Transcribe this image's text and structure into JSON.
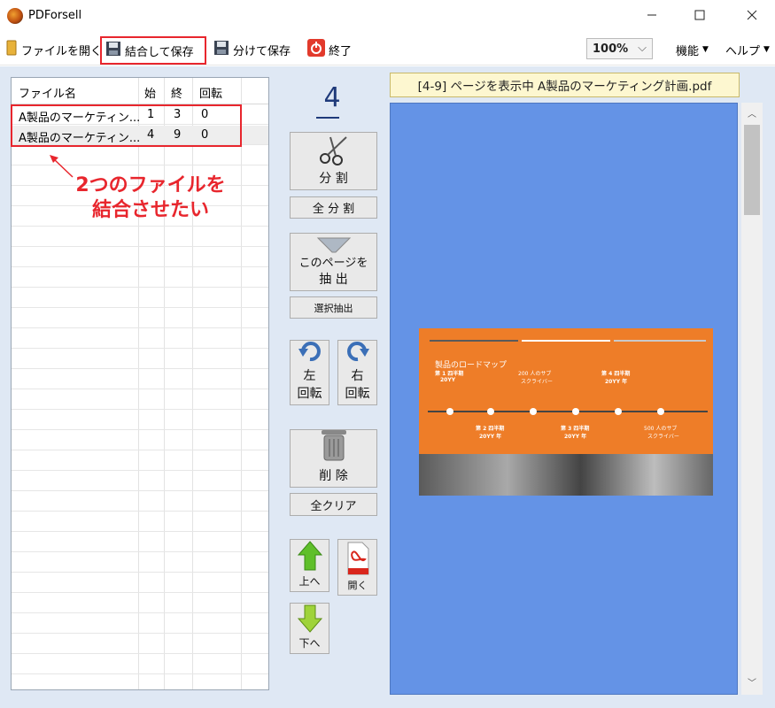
{
  "window": {
    "title": "PDForsell",
    "minimize_icon": "minimize-icon",
    "maximize_icon": "maximize-icon",
    "close_icon": "close-icon"
  },
  "toolbar": {
    "open_label": "ファイルを開く",
    "merge_save_label": "結合して保存",
    "split_save_label": "分けて保存",
    "exit_label": "終了",
    "zoom_value": "100%",
    "features_label": "機能",
    "help_label": "ヘルプ"
  },
  "table": {
    "headers": [
      "ファイル名",
      "始",
      "終",
      "回転"
    ],
    "rows": [
      {
        "name": "A製品のマーケティン...",
        "start": "1",
        "end": "3",
        "rotation": "0"
      },
      {
        "name": "A製品のマーケティン...",
        "start": "4",
        "end": "9",
        "rotation": "0"
      }
    ]
  },
  "annotation": {
    "line1": "2つのファイルを",
    "line2": "結合させたい",
    "color": "#e8262d"
  },
  "controls": {
    "page_count": "4",
    "split_label": "分 割",
    "split_all_label": "全 分 割",
    "extract_label_1": "このページを",
    "extract_label_2": "抽 出",
    "select_extract_label": "選択抽出",
    "rotate_left_1": "左",
    "rotate_left_2": "回転",
    "rotate_right_1": "右",
    "rotate_right_2": "回転",
    "delete_label": "削 除",
    "clear_all_label": "全クリア",
    "move_up_label": "上へ",
    "open_pdf_label": "開く",
    "move_down_label": "下へ"
  },
  "preview": {
    "status": "[4-9] ページを表示中  A製品のマーケティング計画.pdf",
    "slide": {
      "title": "製品のロードマップ",
      "col1_head": "第 1 四半期",
      "col1_year": "20YY",
      "col2_head": "200 人のサブ",
      "col2_sub": "スクライバー",
      "col3_head": "第 4 四半期",
      "col3_year": "20YY 年",
      "low1_head": "第 2 四半期",
      "low1_year": "20YY 年",
      "low2_head": "第 3 四半期",
      "low2_year": "20YY 年",
      "low3_head": "500 人のサブ",
      "low3_sub": "スクライバー"
    },
    "background_color": "#6493e6",
    "slide_color": "#ee7d28"
  }
}
